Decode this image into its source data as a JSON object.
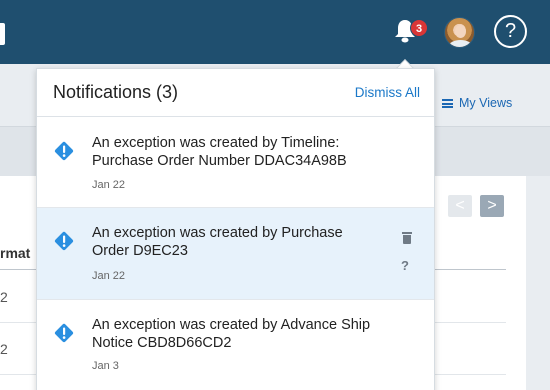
{
  "topbar": {
    "notification_count": "3",
    "help_symbol": "?",
    "icons": [
      "bell-icon",
      "avatar",
      "help-icon"
    ]
  },
  "background": {
    "my_views_label": "My Views",
    "pager_prev": "<",
    "pager_next": ">",
    "column_header_fragment": "rmat",
    "cells": [
      "2",
      "2"
    ]
  },
  "notifications_panel": {
    "title": "Notifications (3)",
    "dismiss_all": "Dismiss All",
    "items": [
      {
        "message": "An exception was created by Timeline: Purchase Order Number DDAC34A98B",
        "date": "Jan 22"
      },
      {
        "message": "An exception was created by Purchase Order D9EC23",
        "date": "Jan 22",
        "help_symbol": "?"
      },
      {
        "message": "An exception was created by Advance Ship Notice CBD8D66CD2",
        "date": "Jan 3"
      }
    ]
  },
  "colors": {
    "topbar": "#1f4f6f",
    "badge": "#d93636",
    "accent_blue": "#1b78c8",
    "exception_icon": "#2a8fe0",
    "selected_row": "#e7f2fb"
  }
}
